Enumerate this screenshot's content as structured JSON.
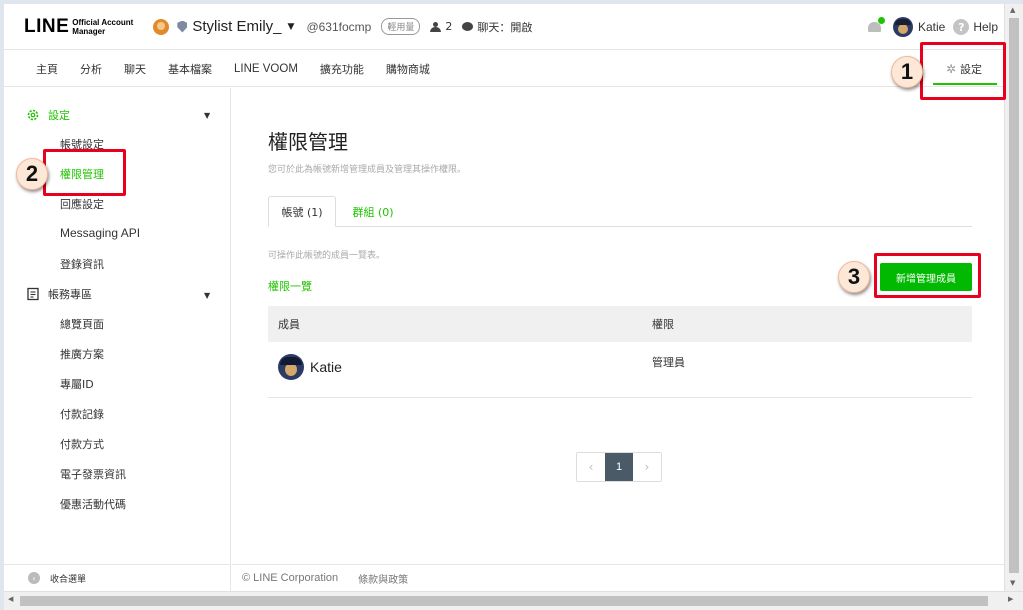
{
  "header": {
    "logo_main": "LINE",
    "logo_sub1": "Official Account",
    "logo_sub2": "Manager",
    "account_name": "Stylist Emily_",
    "account_id": "@631focmp",
    "plan_badge": "輕用量",
    "member_count": "2",
    "chat_status": "聊天：開啟",
    "user_name": "Katie",
    "help_label": "Help"
  },
  "nav": {
    "items": [
      "主頁",
      "分析",
      "聊天",
      "基本檔案",
      "LINE VOOM",
      "擴充功能",
      "購物商城"
    ],
    "settings_label": "設定"
  },
  "sidebar": {
    "group1_label": "設定",
    "group1_items": [
      "帳號設定",
      "權限管理",
      "回應設定",
      "Messaging API",
      "登錄資訊"
    ],
    "group2_label": "帳務專區",
    "group2_items": [
      "總覽頁面",
      "推廣方案",
      "專屬ID",
      "付款記錄",
      "付款方式",
      "電子發票資訊",
      "優惠活動代碼"
    ],
    "collapse_label": "收合選單"
  },
  "main": {
    "title": "權限管理",
    "description": "您可於此為帳號新增管理成員及管理其操作權限。",
    "tab_accounts": "帳號 (1)",
    "tab_groups": "群組 (0)",
    "members_description": "可操作此帳號的成員一覽表。",
    "permission_link": "權限一覽",
    "add_button": "新增管理成員",
    "table": {
      "headers": [
        "成員",
        "權限"
      ],
      "rows": [
        {
          "member": "Katie",
          "role": "管理員"
        }
      ]
    },
    "pagination": {
      "current": "1"
    }
  },
  "footer": {
    "copyright": "© LINE Corporation",
    "terms": "條款與政策"
  },
  "annotations": {
    "step1": "1",
    "step2": "2",
    "step3": "3"
  },
  "colors": {
    "brand_green": "#1fc300",
    "button_green": "#00b900",
    "annotation_red": "#e8001c"
  }
}
